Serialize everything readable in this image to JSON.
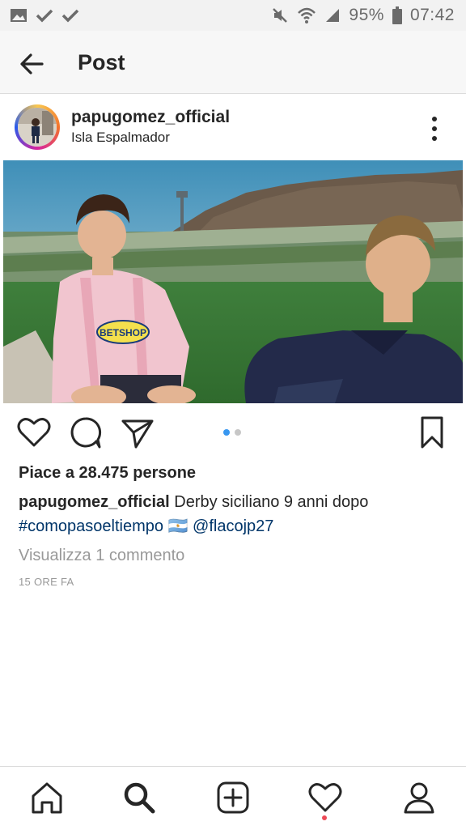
{
  "status_bar": {
    "battery": "95%",
    "time": "07:42",
    "icons_left": [
      "image-icon",
      "check-icon",
      "check-icon"
    ],
    "icons_right": [
      "mute-icon",
      "wifi-icon",
      "signal-icon",
      "battery-icon"
    ]
  },
  "header": {
    "title": "Post"
  },
  "post": {
    "username": "papugomez_official",
    "location": "Isla Espalmador",
    "likes": "Piace a 28.475 persone",
    "caption_user": "papugomez_official",
    "caption_text": "Derby siciliano 9 anni dopo",
    "hashtag": "#comopasoeltiempo",
    "flag_emoji": "🇦🇷",
    "mention": "@flacojp27",
    "view_comments": "Visualizza 1 commento",
    "timestamp": "15 ORE FA",
    "photo_jersey_text": "BETSHOP",
    "carousel": {
      "count": 2,
      "active": 0
    }
  },
  "bottom_nav": [
    "home-icon",
    "search-icon",
    "add-icon",
    "activity-icon",
    "profile-icon"
  ],
  "colors": {
    "accent_blue": "#3897f0",
    "link": "#003569",
    "muted": "#999999",
    "notification": "#ed4956"
  }
}
